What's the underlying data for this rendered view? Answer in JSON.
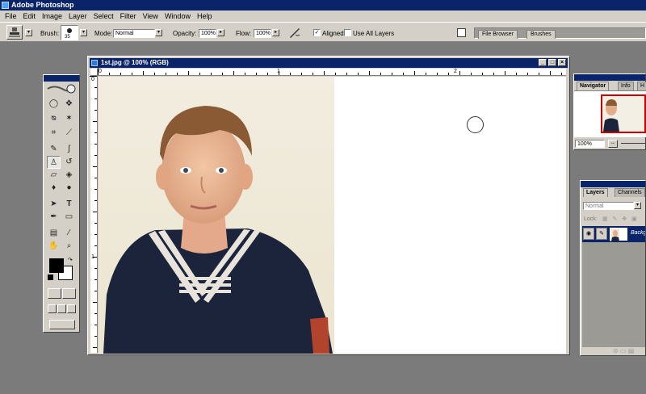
{
  "app": {
    "title": "Adobe Photoshop"
  },
  "menu": [
    "File",
    "Edit",
    "Image",
    "Layer",
    "Select",
    "Filter",
    "View",
    "Window",
    "Help"
  ],
  "options": {
    "brush_label": "Brush:",
    "brush_size": "35",
    "mode_label": "Mode:",
    "mode_value": "Normal",
    "opacity_label": "Opacity:",
    "opacity_value": "100%",
    "flow_label": "Flow:",
    "flow_value": "100%",
    "aligned_label": "Aligned",
    "aligned_checked": true,
    "use_all_layers_label": "Use All Layers",
    "use_all_layers_checked": false
  },
  "palette_well": {
    "tabs": [
      "File Browser",
      "Brushes"
    ]
  },
  "document": {
    "title": "1st.jpg @ 100% (RGB)",
    "ruler_h_labels": [
      "0",
      "1",
      "2"
    ],
    "ruler_v_labels": [
      "0",
      "1"
    ]
  },
  "navigator": {
    "tabs": [
      "Navigator",
      "Info",
      "H"
    ],
    "zoom_value": "100%"
  },
  "layers": {
    "tabs": [
      "Layers",
      "Channels"
    ],
    "blend_mode": "Normal",
    "lock_label": "Lock:",
    "layer_name": "Backg"
  },
  "colors": {
    "titlebar": "#0a246a",
    "chrome": "#d4d0c8",
    "workspace": "#7b7b7b"
  },
  "icons": {
    "clone-stamp-tool": "stamp",
    "brush-preview": "soft-brush-dot",
    "airbrush-toggle": "airbrush"
  }
}
